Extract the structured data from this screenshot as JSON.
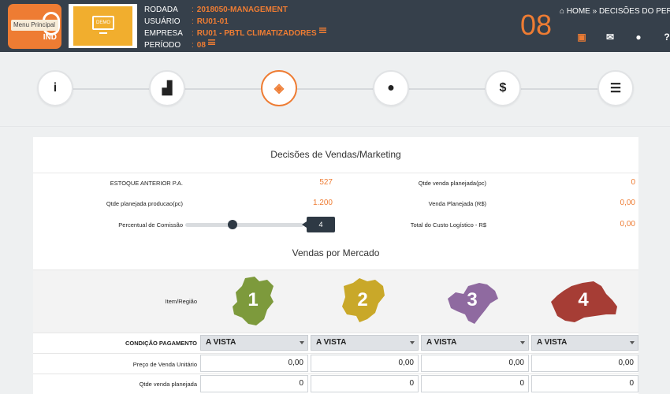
{
  "header": {
    "logo_text": "Menu Principal",
    "logo_badge": "IND",
    "banner_text": "DEMO",
    "info": [
      {
        "label": "RODADA",
        "value": "2018050-MANAGEMENT"
      },
      {
        "label": "USUÁRIO",
        "value": "RU01-01"
      },
      {
        "label": "EMPRESA",
        "value": "RU01 - PBTL CLIMATIZADORES"
      },
      {
        "label": "PERÍODO",
        "value": "08"
      }
    ],
    "period_big": "08",
    "breadcrumb": [
      "HOME",
      "DECISÕES DO PER..."
    ],
    "icons": [
      "save-icon",
      "envelope-icon",
      "user-icon",
      "help-icon"
    ],
    "accent_color": "#ee7c33",
    "bar_color": "#36404b"
  },
  "steps": {
    "items": [
      {
        "icon": "info-icon",
        "glyph": "i"
      },
      {
        "icon": "factory-icon",
        "glyph": "▟"
      },
      {
        "icon": "tags-icon",
        "glyph": "◈"
      },
      {
        "icon": "user-icon",
        "glyph": "●"
      },
      {
        "icon": "dollar-icon",
        "glyph": "$"
      },
      {
        "icon": "list-icon",
        "glyph": "☰"
      }
    ],
    "active_index": 2
  },
  "panel": {
    "title": "Decisões de Vendas/Marketing",
    "left": [
      {
        "label": "ESTOQUE ANTERIOR P.A.",
        "value": "527"
      },
      {
        "label": "Qtde planejada producao(pc)",
        "value": "1.200"
      }
    ],
    "right": [
      {
        "label": "Qtde venda planejada(pc)",
        "value": "0"
      },
      {
        "label": "Venda Planejada (R$)",
        "value": "0,00"
      },
      {
        "label": "Total do Custo Logístico - R$",
        "value": "0,00"
      }
    ],
    "commission": {
      "label": "Percentual de Comissão",
      "value": "4",
      "fraction": 0.4
    },
    "markets_title": "Vendas por Mercado",
    "item_region_label": "Item/Região",
    "markets": [
      {
        "number": "1",
        "color": "#7d9a3c"
      },
      {
        "number": "2",
        "color": "#c9a829"
      },
      {
        "number": "3",
        "color": "#8f6aa0"
      },
      {
        "number": "4",
        "color": "#a63d35"
      }
    ],
    "rows": {
      "payment_label": "CONDIÇÃO PAGAMENTO",
      "payment_values": [
        "A VISTA",
        "A VISTA",
        "A VISTA",
        "A VISTA"
      ],
      "price_label": "Preço de Venda Unitário",
      "price_values": [
        "0,00",
        "0,00",
        "0,00",
        "0,00"
      ],
      "qty_label": "Qtde venda planejada",
      "qty_values": [
        "0",
        "0",
        "0",
        "0"
      ]
    }
  }
}
